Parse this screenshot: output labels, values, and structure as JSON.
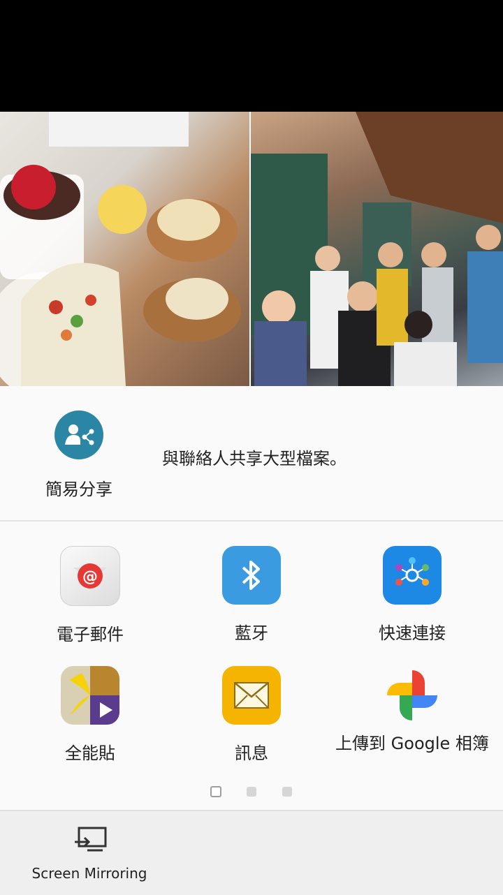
{
  "easy_share": {
    "label": "簡易分享",
    "description": "與聯絡人共享大型檔案。"
  },
  "apps": [
    {
      "label": "電子郵件",
      "icon": "email-icon"
    },
    {
      "label": "藍牙",
      "icon": "bluetooth-icon"
    },
    {
      "label": "快速連接",
      "icon": "quick-connect-icon"
    },
    {
      "label": "全能貼",
      "icon": "scrapbook-icon"
    },
    {
      "label": "訊息",
      "icon": "messages-icon"
    },
    {
      "label": "上傳到 Google 相簿",
      "icon": "google-photos-icon"
    }
  ],
  "pager": {
    "count": 3,
    "current": 1
  },
  "bottom": {
    "label": "Screen Mirroring",
    "icon": "screen-mirroring-icon"
  },
  "colors": {
    "easy_share": "#2b86a5",
    "bluetooth": "#3a9be0",
    "messages": "#f5b400",
    "email_red": "#e53935"
  }
}
